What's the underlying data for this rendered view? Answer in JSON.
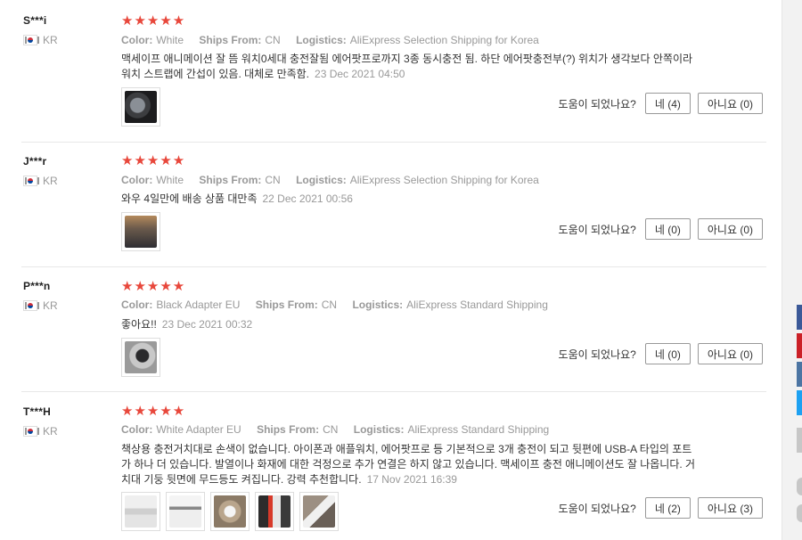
{
  "helpful_question": "도움이 되었나요?",
  "reviews": [
    {
      "name": "S***i",
      "country": "KR",
      "stars": "★★★★★",
      "meta": [
        {
          "label": "Color:",
          "value": "White"
        },
        {
          "label": "Ships From:",
          "value": "CN"
        },
        {
          "label": "Logistics:",
          "value": "AliExpress Selection Shipping for Korea"
        }
      ],
      "text": "맥세이프 애니메이션 잘 뜸 워치0세대 충전잘됨 에어팟프로까지 3종 동시충전 됨. 하단 에어팟충전부(?) 위치가 생각보다 안쪽이라 워치 스트랩에 간섭이 있음. 대체로 만족함.",
      "date": "23 Dec 2021 04:50",
      "yes": "네 (4)",
      "no": "아니요 (0)"
    },
    {
      "name": "J***r",
      "country": "KR",
      "stars": "★★★★★",
      "meta": [
        {
          "label": "Color:",
          "value": "White"
        },
        {
          "label": "Ships From:",
          "value": "CN"
        },
        {
          "label": "Logistics:",
          "value": "AliExpress Selection Shipping for Korea"
        }
      ],
      "text": "와우 4일만에 배송 상품 대만족",
      "date": "22 Dec 2021 00:56",
      "yes": "네 (0)",
      "no": "아니요 (0)"
    },
    {
      "name": "P***n",
      "country": "KR",
      "stars": "★★★★★",
      "meta": [
        {
          "label": "Color:",
          "value": "Black Adapter EU"
        },
        {
          "label": "Ships From:",
          "value": "CN"
        },
        {
          "label": "Logistics:",
          "value": "AliExpress Standard Shipping"
        }
      ],
      "text": "좋아요!!",
      "date": "23 Dec 2021 00:32",
      "yes": "네 (0)",
      "no": "아니요 (0)"
    },
    {
      "name": "T***H",
      "country": "KR",
      "stars": "★★★★★",
      "meta": [
        {
          "label": "Color:",
          "value": "White Adapter EU"
        },
        {
          "label": "Ships From:",
          "value": "CN"
        },
        {
          "label": "Logistics:",
          "value": "AliExpress Standard Shipping"
        }
      ],
      "text": "책상용 충전거치대로 손색이 없습니다. 아이폰과 애플워치, 에어팟프로 등 기본적으로 3개 충전이 되고 뒷편에 USB-A 타입의 포트가 하나 더 있습니다. 발열이나 화재에 대한 걱정으로 추가 연결은 하지 않고 있습니다. 맥세이프 충전 애니메이션도 잘 나옵니다. 거치대 기둥 뒷면에 무드등도 켜집니다. 강력 추천합니다.",
      "date": "17 Nov 2021 16:39",
      "yes": "네 (2)",
      "no": "아니요 (3)"
    }
  ],
  "colors": {
    "star": "#e8473b",
    "side_facebook": "#3b5998",
    "side_pinterest": "#cb2027",
    "side_vk": "#4c75a3",
    "side_twitter": "#1da1f2"
  }
}
